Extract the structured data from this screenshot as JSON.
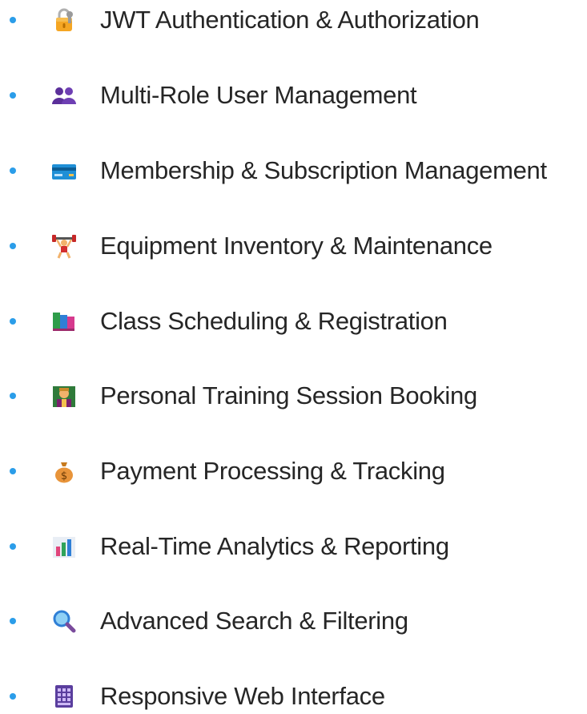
{
  "features": [
    {
      "label": "JWT Authentication & Authorization",
      "icon": "lock-key-icon"
    },
    {
      "label": "Multi-Role User Management",
      "icon": "users-icon"
    },
    {
      "label": "Membership & Subscription Management",
      "icon": "credit-card-icon"
    },
    {
      "label": "Equipment Inventory & Maintenance",
      "icon": "weightlifter-icon"
    },
    {
      "label": "Class Scheduling & Registration",
      "icon": "books-icon"
    },
    {
      "label": "Personal Training Session Booking",
      "icon": "trainer-icon"
    },
    {
      "label": "Payment Processing & Tracking",
      "icon": "money-bag-icon"
    },
    {
      "label": "Real-Time Analytics & Reporting",
      "icon": "bar-chart-icon"
    },
    {
      "label": "Advanced Search & Filtering",
      "icon": "magnifier-icon"
    },
    {
      "label": "Responsive Web Interface",
      "icon": "keypad-icon"
    }
  ],
  "colors": {
    "bullet": "#2b9de9",
    "text": "#262626"
  }
}
